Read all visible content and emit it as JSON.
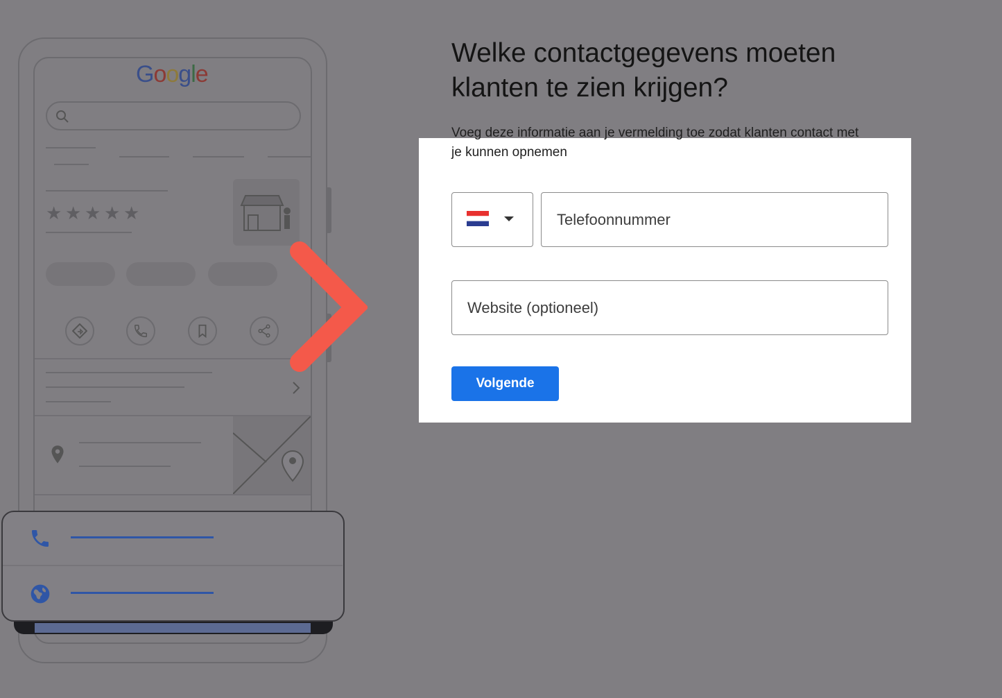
{
  "illustration": {
    "logo_letters": [
      "G",
      "o",
      "o",
      "g",
      "l",
      "e"
    ],
    "rating_stars": 5,
    "phone_icon": "phone-icon",
    "globe_icon": "globe-icon",
    "pin_icon": "map-pin-icon",
    "action_icons": [
      "directions-icon",
      "call-icon",
      "bookmark-icon",
      "share-icon"
    ]
  },
  "form": {
    "heading": "Welke contactgegevens moeten klanten te zien krijgen?",
    "subtext_line1": "Voeg deze informatie aan je vermelding toe zodat klanten contact met",
    "subtext_line2": "je kunnen opnemen",
    "country_flag": "netherlands-flag",
    "phone_placeholder": "Telefoonnummer",
    "website_placeholder": "Website (optioneel)",
    "next_label": "Volgende"
  },
  "colors": {
    "primary_button": "#1a73e8",
    "arrow_start": "#ffffff",
    "arrow_end": "#f4594a",
    "backdrop": "#807e82"
  }
}
